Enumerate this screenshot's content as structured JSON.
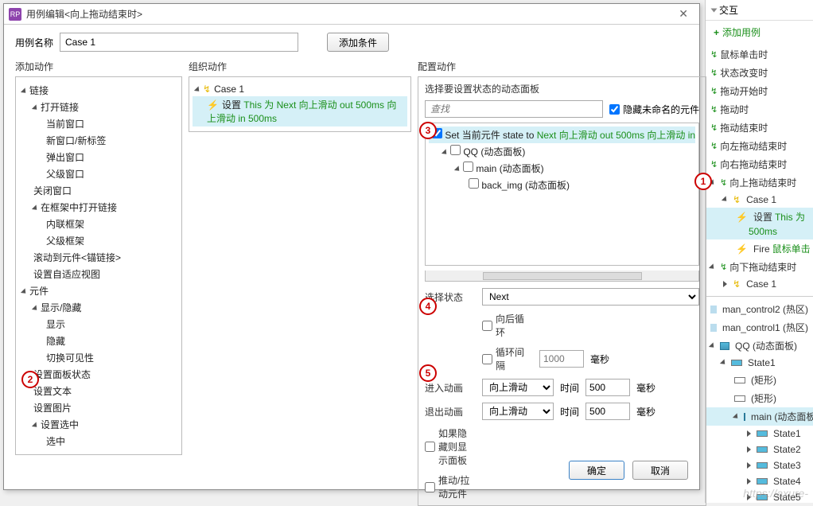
{
  "dialog": {
    "title": "用例编辑<向上拖动结束时>",
    "case_name_label": "用例名称",
    "case_name_value": "Case 1",
    "add_condition_btn": "添加条件",
    "add_action_header": "添加动作",
    "organize_header": "组织动作",
    "config_header": "配置动作",
    "ok_btn": "确定",
    "cancel_btn": "取消"
  },
  "add_actions": {
    "links": "链接",
    "open_link": "打开链接",
    "current_window": "当前窗口",
    "new_window": "新窗口/新标签",
    "popup_window": "弹出窗口",
    "parent_window": "父级窗口",
    "close_window": "关闭窗口",
    "open_in_frame": "在框架中打开链接",
    "inline_frame": "内联框架",
    "parent_frame": "父级框架",
    "scroll_to": "滚动到元件<锚链接>",
    "set_adaptive": "设置自适应视图",
    "widgets": "元件",
    "show_hide": "显示/隐藏",
    "show": "显示",
    "hide": "隐藏",
    "toggle_vis": "切换可见性",
    "set_panel_state": "设置面板状态",
    "set_text": "设置文本",
    "set_image": "设置图片",
    "set_selected": "设置选中",
    "selected": "选中"
  },
  "org": {
    "case1": "Case 1",
    "action_prefix": "设置 ",
    "action_green1": "This 为 Next 向上滑动 out 500ms 向上滑动 in 500ms"
  },
  "config": {
    "select_panel_label": "选择要设置状态的动态面板",
    "search_placeholder": "查找",
    "hide_unnamed": "隐藏未命名的元件",
    "set_current_prefix": "Set 当前元件 state to ",
    "set_current_green": "Next 向上滑动 out 500ms 向上滑动 in",
    "qq_panel": "QQ (动态面板)",
    "main_panel": "main (动态面板)",
    "back_img": "back_img (动态面板)",
    "select_state_label": "选择状态",
    "select_state_value": "Next",
    "wrap_label": "向后循环",
    "repeat_label": "循环间隔",
    "repeat_placeholder": "1000",
    "repeat_unit": "毫秒",
    "animate_in_label": "进入动画",
    "animate_out_label": "退出动画",
    "anim_value": "向上滑动",
    "time_label": "时间",
    "time_value": "500",
    "time_unit": "毫秒",
    "show_if_hidden": "如果隐藏则显示面板",
    "push_pull": "推动/拉动元件"
  },
  "right": {
    "interactions_title": "交互",
    "add_case": "添加用例",
    "events": {
      "click": "鼠标单击时",
      "state_change": "状态改变时",
      "drag_start": "拖动开始时",
      "drag": "拖动时",
      "drag_end": "拖动结束时",
      "swipe_left_end": "向左拖动结束时",
      "swipe_right_end": "向右拖动结束时",
      "swipe_up_end": "向上拖动结束时",
      "swipe_down_end": "向下拖动结束时"
    },
    "case1": "Case 1",
    "action_set": "设置 ",
    "action_set_green": "This 为",
    "action_set_line2": "500ms",
    "action_fire": "Fire ",
    "action_fire_green": "鼠标单击",
    "outline": {
      "man_control2": "man_control2 (热区)",
      "man_control1": "man_control1 (热区)",
      "qq": "QQ (动态面板)",
      "state1": "State1",
      "rect1": "(矩形)",
      "rect2": "(矩形)",
      "main": "main (动态面板",
      "s1": "State1",
      "s2": "State2",
      "s3": "State3",
      "s4": "State4",
      "s5": "State5"
    }
  },
  "watermark": "https://axure-"
}
